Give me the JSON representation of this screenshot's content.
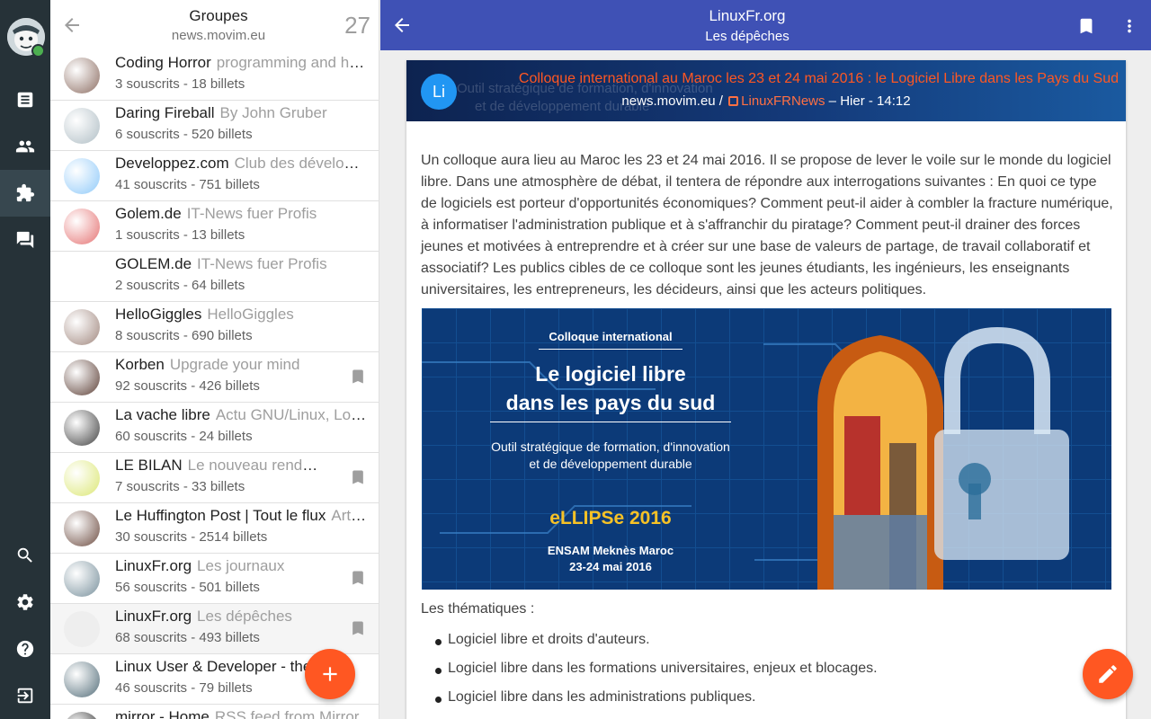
{
  "rail": {
    "items": [
      {
        "name": "news",
        "icon": "newspaper-icon"
      },
      {
        "name": "contacts",
        "icon": "people-icon"
      },
      {
        "name": "communities",
        "icon": "puzzle-icon"
      },
      {
        "name": "chats",
        "icon": "chat-icon"
      },
      {
        "name": "search",
        "icon": "search-icon"
      },
      {
        "name": "configuration",
        "icon": "gear-icon"
      },
      {
        "name": "help",
        "icon": "help-icon"
      },
      {
        "name": "logout",
        "icon": "logout-icon"
      }
    ],
    "active": "communities"
  },
  "groups": {
    "title": "Groupes",
    "server": "news.movim.eu",
    "count": "27",
    "items": [
      {
        "name": "Coding Horror",
        "desc": "programming and human factors",
        "stats": "3 souscrits - 18 billets",
        "bookmarked": false
      },
      {
        "name": "Daring Fireball",
        "desc": "By John Gruber",
        "stats": "6 souscrits - 520 billets",
        "bookmarked": false
      },
      {
        "name": "Developpez.com",
        "desc": "Club des développeurs et IT pro",
        "stats": "41 souscrits - 751 billets",
        "bookmarked": false
      },
      {
        "name": "Golem.de",
        "desc": "IT-News fuer Profis",
        "stats": "1 souscrits - 13 billets",
        "bookmarked": false
      },
      {
        "name": "GOLEM.de",
        "desc": "IT-News fuer Profis",
        "stats": "2 souscrits - 64 billets",
        "bookmarked": false
      },
      {
        "name": "HelloGiggles",
        "desc": "HelloGiggles",
        "stats": "8 souscrits - 690 billets",
        "bookmarked": false
      },
      {
        "name": "Korben",
        "desc": "Upgrade your mind",
        "stats": "92 souscrits - 426 billets",
        "bookmarked": true
      },
      {
        "name": "La vache libre",
        "desc": "Actu GNU/Linux, Logiciels libres",
        "stats": "60 souscrits - 24 billets",
        "bookmarked": false
      },
      {
        "name": "LE BILAN",
        "desc": "Le nouveau rendez-vous",
        "stats": "7 souscrits - 33 billets",
        "bookmarked": true
      },
      {
        "name": "Le Huffington Post | Tout le flux",
        "desc": "Articles",
        "stats": "30 souscrits - 2514 billets",
        "bookmarked": false
      },
      {
        "name": "LinuxFr.org",
        "desc": "Les journaux",
        "stats": "56 souscrits - 501 billets",
        "bookmarked": true
      },
      {
        "name": "LinuxFr.org",
        "desc": "Les dépêches",
        "stats": "68 souscrits - 493 billets",
        "bookmarked": true,
        "selected": true
      },
      {
        "name": "Linux User & Developer - the",
        "desc": "",
        "stats": "46 souscrits - 79 billets",
        "bookmarked": false
      },
      {
        "name": "mirror - Home",
        "desc": "RSS feed from Mirror",
        "stats": "",
        "bookmarked": false
      }
    ]
  },
  "topbar": {
    "title": "LinuxFr.org",
    "subtitle": "Les dépêches"
  },
  "post": {
    "avatar_initials": "Li",
    "title": "Colloque international au Maroc les 23 et 24 mai 2016 : le Logiciel Libre dans les Pays du Sud",
    "server": "news.movim.eu",
    "separator": " / ",
    "source": "LinuxFRNews",
    "date": " – Hier - 14:12",
    "banner_ghost_1": "Outil stratégique de formation, d'innovation",
    "banner_ghost_2": "et de développement durable",
    "paragraph": "Un colloque aura lieu au Maroc les 23 et 24 mai 2016. Il se propose de lever le voile sur le monde du logiciel libre. Dans une atmosphère de débat, il tentera de répondre aux interrogations suivantes : En quoi ce type de logiciels est porteur d'opportunités économiques? Comment peut-il aider à combler la fracture numérique, à informatiser l'administration publique et à s'affranchir du piratage? Comment peut-il drainer des forces jeunes et motivées à entreprendre et à créer sur une base de valeurs de partage, de travail collaboratif et associatif? Les publics cibles de ce colloque sont les jeunes étudiants, les ingénieurs, les enseignants universitaires, les entrepreneurs, les décideurs, ainsi que les acteurs politiques.",
    "image": {
      "kicker": "Colloque international",
      "headline_1": "Le logiciel libre",
      "headline_2": "dans les pays du sud",
      "sub_1": "Outil stratégique de formation, d'innovation",
      "sub_2": "et de développement durable",
      "event": "eLLIPSe 2016",
      "place": "ENSAM Meknès Maroc",
      "dates": "23-24 mai 2016"
    },
    "themes_label": "Les thématiques :",
    "themes": [
      "Logiciel libre et droits d'auteurs.",
      "Logiciel libre dans les formations universitaires, enjeux et blocages.",
      "Logiciel libre dans les administrations publiques."
    ]
  },
  "colors": {
    "rail": "#263238",
    "appbar": "#3f51b5",
    "accent": "#ff5722",
    "presence": "#4caf50"
  }
}
